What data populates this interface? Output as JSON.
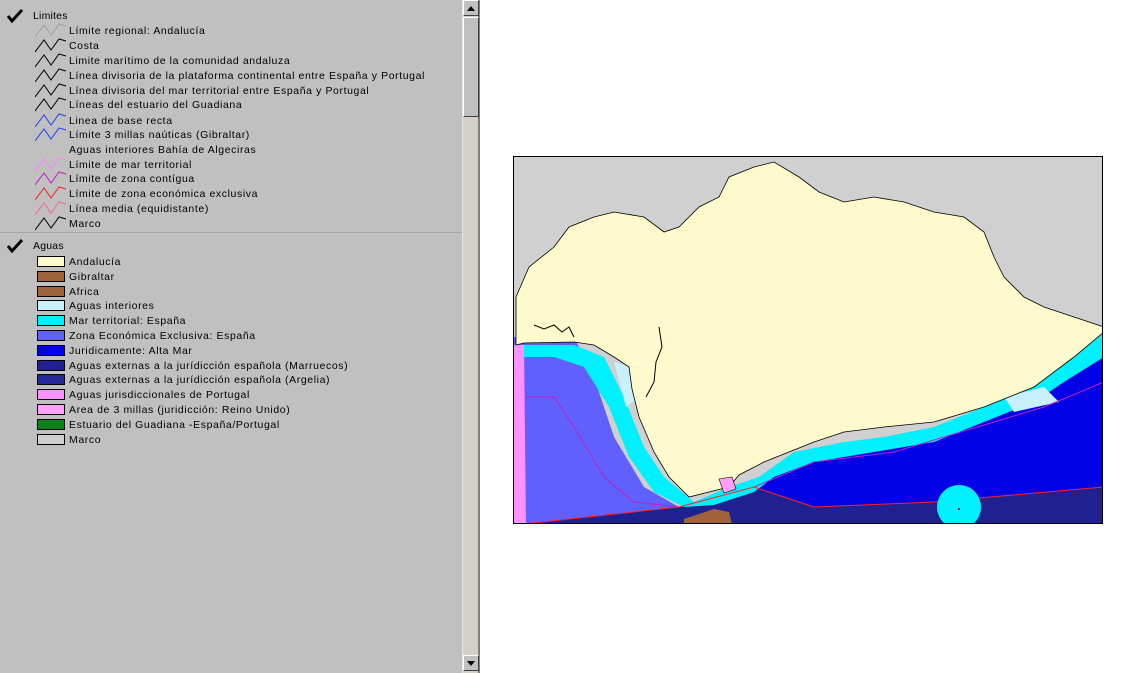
{
  "legend": {
    "groups": [
      {
        "label": "Limites",
        "checked": true,
        "items": [
          {
            "label": "Límite regional: Andalucía",
            "color": "#a0a0a0"
          },
          {
            "label": "Costa",
            "color": "#000000"
          },
          {
            "label": "Limite marítimo de la comunidad andaluza",
            "color": "#000000"
          },
          {
            "label": "Línea divisoria de la plataforma continental entre España y Portugal",
            "color": "#000000"
          },
          {
            "label": "Línea divisoria del mar territorial entre España y Portugal",
            "color": "#000000"
          },
          {
            "label": "Líneas del estuario del Guadiana",
            "color": "#000000"
          },
          {
            "label": "Linea de base recta",
            "color": "#2040ff"
          },
          {
            "label": "Límite 3 millas naúticas (Gibraltar)",
            "color": "#2040ff"
          },
          {
            "label": "Aguas interiores Bahía de Algeciras",
            "color": ""
          },
          {
            "label": "Límite de mar territorial",
            "color": "#ff80ff"
          },
          {
            "label": "Límite de zona contígua",
            "color": "#c020c0"
          },
          {
            "label": "Límite de zona económica exclusiva",
            "color": "#ff2020"
          },
          {
            "label": "Línea media (equidistante)",
            "color": "#ff60a0"
          },
          {
            "label": "Marco",
            "color": "#000000"
          }
        ]
      },
      {
        "label": "Aguas",
        "checked": true,
        "items": [
          {
            "label": "Andalucía",
            "color": "#fffacd"
          },
          {
            "label": "Gibraltar",
            "color": "#a0643c"
          },
          {
            "label": "Africa",
            "color": "#a0643c"
          },
          {
            "label": "Aguas interiores",
            "color": "#c8f0ff"
          },
          {
            "label": "Mar territorial: España",
            "color": "#00f0ff"
          },
          {
            "label": "Zona Económica Exclusiva: España",
            "color": "#6060ff"
          },
          {
            "label": "Juridicamente: Alta Mar",
            "color": "#0000e6"
          },
          {
            "label": "Aguas externas a la jurídicción española (Marruecos)",
            "color": "#202090"
          },
          {
            "label": "Aguas externas a la jurídicción española (Argelia)",
            "color": "#282898"
          },
          {
            "label": "Aguas jurisdiccionales de Portugal",
            "color": "#ff90ff"
          },
          {
            "label": "Area de 3 millas (juridicción: Reino Unido)",
            "color": "#ffa0ff"
          },
          {
            "label": "Estuario del Guadiana -España/Portugal",
            "color": "#10801a"
          },
          {
            "label": "Marco",
            "color": "#d0d0d0"
          }
        ]
      }
    ]
  },
  "map": {
    "colors": {
      "frame_bg": "#d0d0d0",
      "andalucia": "#fffacd",
      "aguas_interiores": "#c8f0ff",
      "mar_territorial": "#00f0ff",
      "zee": "#6060ff",
      "alta_mar": "#0000e6",
      "marruecos": "#202090",
      "portugal": "#ff90ff",
      "africa": "#a0643c",
      "coast_line": "#000000",
      "zone_line": "#c020c0",
      "median_line": "#ff2020"
    }
  }
}
